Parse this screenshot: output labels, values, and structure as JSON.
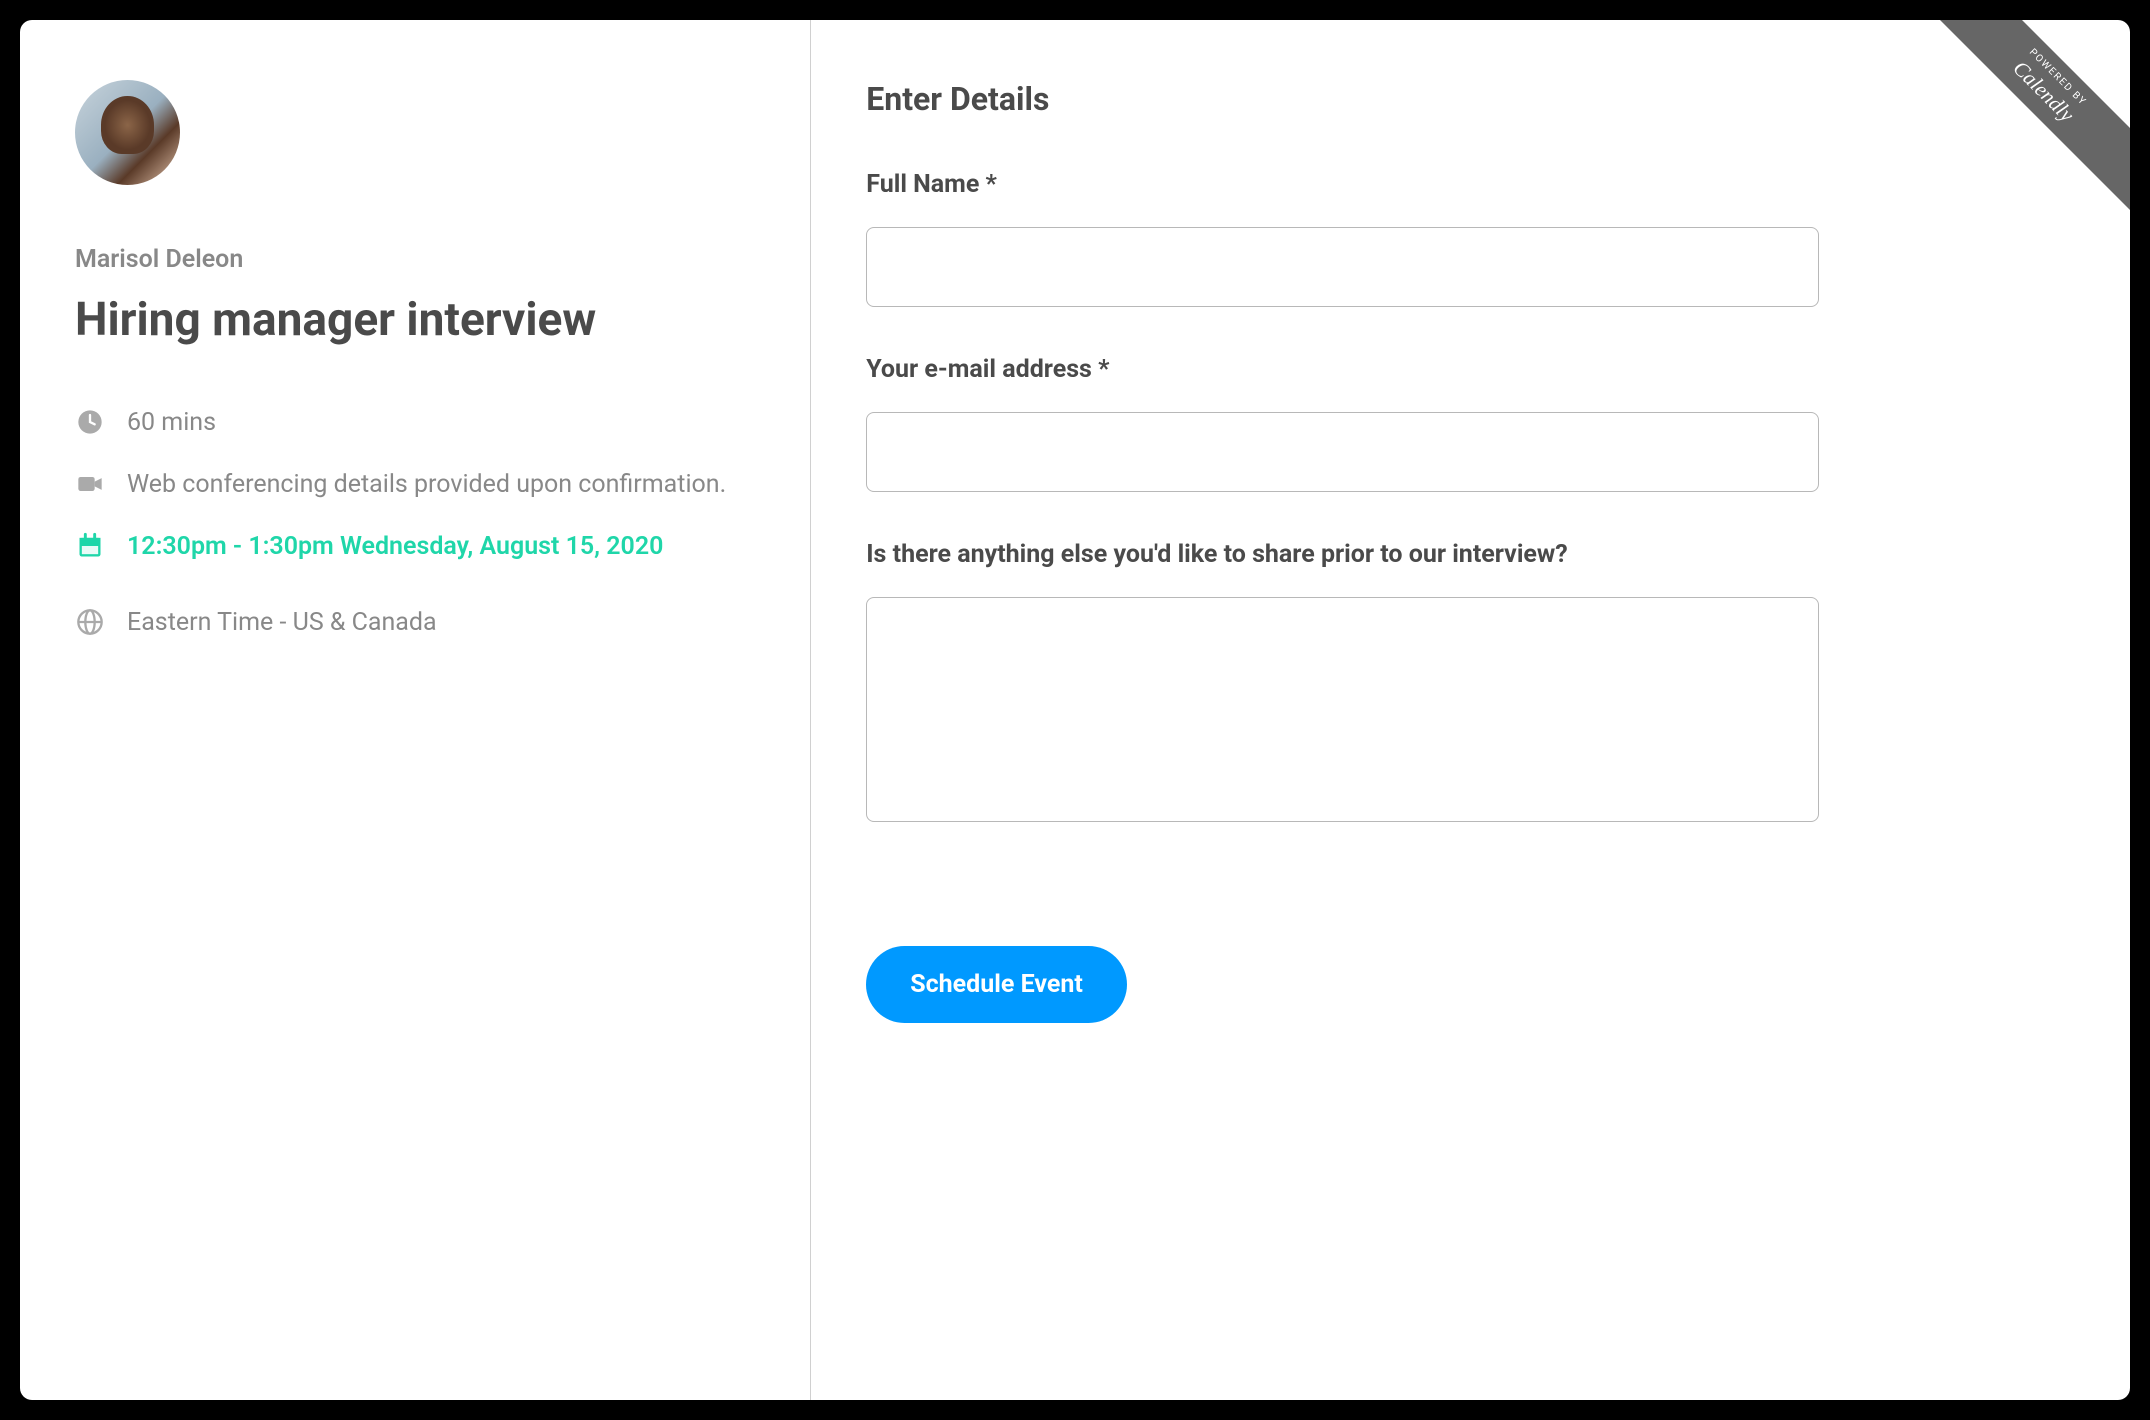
{
  "host": {
    "name": "Marisol Deleon"
  },
  "event": {
    "title": "Hiring manager interview",
    "duration": "60 mins",
    "location_note": "Web conferencing details provided upon confirmation.",
    "datetime": "12:30pm - 1:30pm Wednesday, August 15, 2020",
    "timezone": "Eastern Time - US & Canada"
  },
  "form": {
    "heading": "Enter Details",
    "fields": {
      "full_name": {
        "label": "Full Name *",
        "value": ""
      },
      "email": {
        "label": "Your e-mail address *",
        "value": ""
      },
      "notes": {
        "label": "Is there anything else you'd like to share prior to our interview?",
        "value": ""
      }
    },
    "submit_label": "Schedule Event"
  },
  "ribbon": {
    "small": "POWERED BY",
    "large": "Calendly"
  },
  "colors": {
    "accent_teal": "#1fd6a9",
    "button_blue": "#0099ff",
    "text_dark": "#4a4a4a",
    "text_muted": "#888"
  }
}
